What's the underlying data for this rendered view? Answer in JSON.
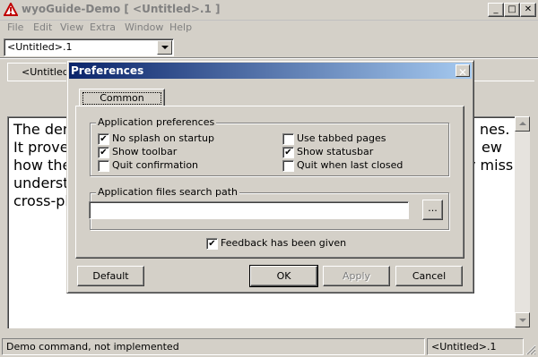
{
  "window": {
    "title": "wyoGuide-Demo  [ <Untitled>.1 ]",
    "minimize_glyph": "_",
    "maximize_glyph": "□",
    "close_glyph": "✕"
  },
  "menu": [
    "File",
    "Edit",
    "View",
    "Extra",
    "Window",
    "Help"
  ],
  "document_selector": {
    "value": "<Untitled>.1"
  },
  "doc_tab": {
    "label": "<Untitled>"
  },
  "editor": {
    "lines": [
      "The dem",
      "It proves",
      "how the",
      "understa",
      "cross-pla"
    ],
    "right_fragments": [
      "nes.",
      "ew",
      "v miss"
    ]
  },
  "status": {
    "message": "Demo command, not implemented",
    "document": "<Untitled>.1"
  },
  "dialog": {
    "title": "Preferences",
    "close_glyph": "✕",
    "tab_label": "Common",
    "app_prefs": {
      "label": "Application preferences",
      "options": [
        {
          "label": "No splash on startup",
          "checked": true
        },
        {
          "label": "Show toolbar",
          "checked": true
        },
        {
          "label": "Quit confirmation",
          "checked": false
        },
        {
          "label": "Use tabbed pages",
          "checked": false
        },
        {
          "label": "Show statusbar",
          "checked": true
        },
        {
          "label": "Quit when last closed",
          "checked": false
        }
      ]
    },
    "search_path": {
      "label": "Application files search path",
      "value": "",
      "browse_label": "..."
    },
    "feedback": {
      "label": "Feedback has been given",
      "checked": true
    },
    "buttons": {
      "default": "Default",
      "ok": "OK",
      "apply": "Apply",
      "cancel": "Cancel"
    }
  }
}
